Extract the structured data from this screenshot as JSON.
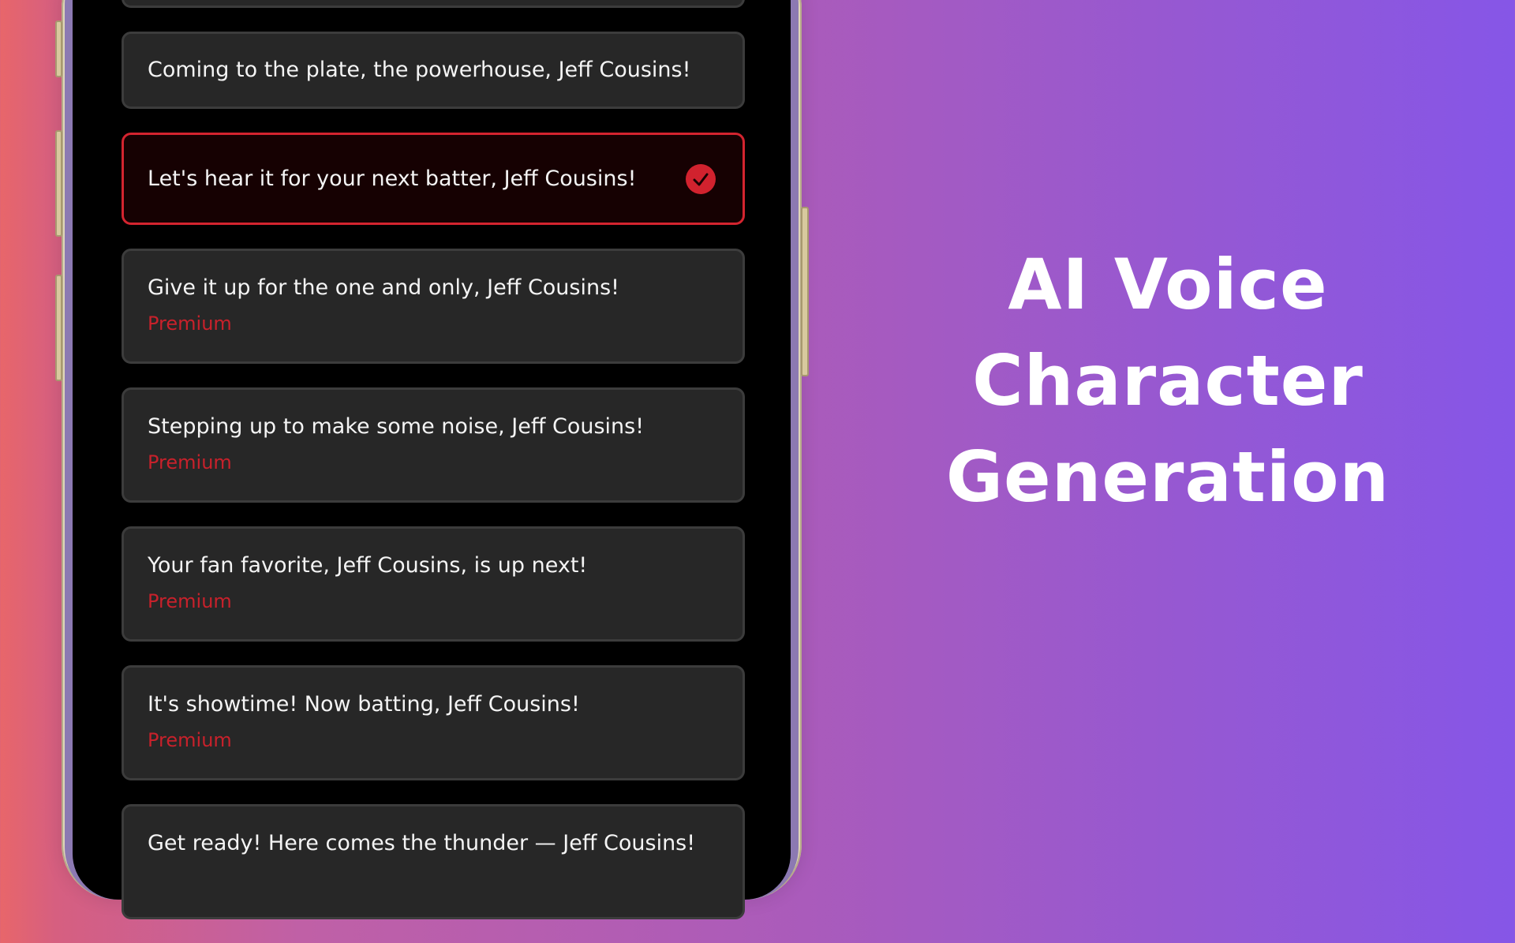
{
  "options": [
    {
      "text": "",
      "premium": ""
    },
    {
      "text": "Coming to the plate, the powerhouse, Jeff Cousins!",
      "premium": ""
    },
    {
      "text": "Let's hear it for your next batter, Jeff Cousins!",
      "premium": "",
      "selected": true
    },
    {
      "text": "Give it up for the one and only, Jeff Cousins!",
      "premium": "Premium"
    },
    {
      "text": "Stepping up to make some noise, Jeff Cousins!",
      "premium": "Premium"
    },
    {
      "text": "Your fan favorite, Jeff Cousins, is up next!",
      "premium": "Premium"
    },
    {
      "text": "It's showtime! Now batting, Jeff Cousins!",
      "premium": "Premium"
    },
    {
      "text": "Get ready! Here comes the thunder — Jeff Cousins!",
      "premium": ""
    }
  ],
  "headline": {
    "line1": "AI Voice",
    "line2": "Character",
    "line3": "Generation"
  },
  "colors": {
    "accent_red": "#d1222e",
    "card_bg": "#272727",
    "selected_bg": "#160102",
    "background_start": "#e8666a",
    "background_end": "#8656e7"
  },
  "icons": {
    "selected_indicator": "checkmark-icon"
  }
}
